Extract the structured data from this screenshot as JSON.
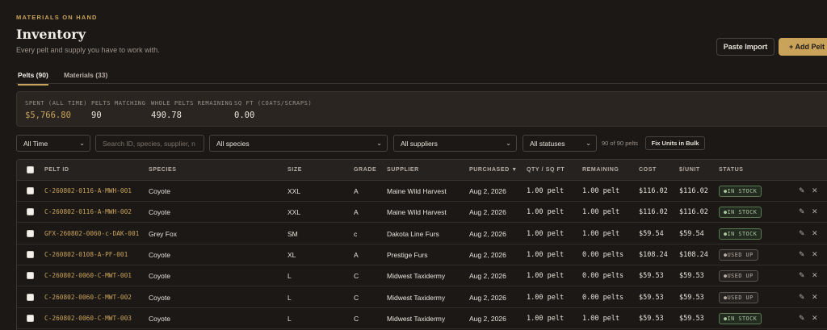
{
  "header": {
    "eyebrow": "MATERIALS ON HAND",
    "title": "Inventory",
    "subtitle": "Every pelt and supply you have to work with.",
    "paste_import_label": "Paste Import",
    "add_pelt_label": "+ Add Pelt"
  },
  "tabs": [
    {
      "label": "Pelts (90)",
      "active": true
    },
    {
      "label": "Materials (33)",
      "active": false
    }
  ],
  "stats": [
    {
      "label": "SPENT (ALL TIME)",
      "value": "$5,766.80"
    },
    {
      "label": "PELTS MATCHING",
      "value": "90"
    },
    {
      "label": "WHOLE PELTS REMAINING",
      "value": "490.78"
    },
    {
      "label": "SQ FT (COATS/SCRAPS)",
      "value": "0.00"
    }
  ],
  "filters": {
    "time": "All Time",
    "search_placeholder": "Search ID, species, supplier, n",
    "species": "All species",
    "suppliers": "All suppliers",
    "statuses": "All statuses",
    "count_text": "90 of 90 pelts",
    "fix_units_label": "Fix Units in Bulk"
  },
  "columns": [
    "PELT ID",
    "SPECIES",
    "SIZE",
    "GRADE",
    "SUPPLIER",
    "PURCHASED ▼",
    "QTY / SQ FT",
    "REMAINING",
    "COST",
    "$/UNIT",
    "STATUS"
  ],
  "rows": [
    {
      "id": "C-260802-0116-A-MWH-001",
      "species": "Coyote",
      "size": "XXL",
      "grade": "A",
      "supplier": "Maine Wild Harvest",
      "purchased": "Aug 2, 2026",
      "qty": "1.00 pelt",
      "remaining": "1.00 pelt",
      "cost": "$116.02",
      "unit": "$116.02",
      "status": "IN STOCK"
    },
    {
      "id": "C-260802-0116-A-MWH-002",
      "species": "Coyote",
      "size": "XXL",
      "grade": "A",
      "supplier": "Maine Wild Harvest",
      "purchased": "Aug 2, 2026",
      "qty": "1.00 pelt",
      "remaining": "1.00 pelt",
      "cost": "$116.02",
      "unit": "$116.02",
      "status": "IN STOCK"
    },
    {
      "id": "GFX-260802-0060-c-DAK-001",
      "species": "Grey Fox",
      "size": "SM",
      "grade": "c",
      "supplier": "Dakota Line Furs",
      "purchased": "Aug 2, 2026",
      "qty": "1.00 pelt",
      "remaining": "1.00 pelt",
      "cost": "$59.54",
      "unit": "$59.54",
      "status": "IN STOCK"
    },
    {
      "id": "C-260802-0108-A-PF-001",
      "species": "Coyote",
      "size": "XL",
      "grade": "A",
      "supplier": "Prestige Furs",
      "purchased": "Aug 2, 2026",
      "qty": "1.00 pelt",
      "remaining": "0.00 pelts",
      "cost": "$108.24",
      "unit": "$108.24",
      "status": "USED UP"
    },
    {
      "id": "C-260802-0060-C-MWT-001",
      "species": "Coyote",
      "size": "L",
      "grade": "C",
      "supplier": "Midwest Taxidermy",
      "purchased": "Aug 2, 2026",
      "qty": "1.00 pelt",
      "remaining": "0.00 pelts",
      "cost": "$59.53",
      "unit": "$59.53",
      "status": "USED UP"
    },
    {
      "id": "C-260802-0060-C-MWT-002",
      "species": "Coyote",
      "size": "L",
      "grade": "C",
      "supplier": "Midwest Taxidermy",
      "purchased": "Aug 2, 2026",
      "qty": "1.00 pelt",
      "remaining": "0.00 pelts",
      "cost": "$59.53",
      "unit": "$59.53",
      "status": "USED UP"
    },
    {
      "id": "C-260802-0060-C-MWT-003",
      "species": "Coyote",
      "size": "L",
      "grade": "C",
      "supplier": "Midwest Taxidermy",
      "purchased": "Aug 2, 2026",
      "qty": "1.00 pelt",
      "remaining": "1.00 pelt",
      "cost": "$59.53",
      "unit": "$59.53",
      "status": "IN STOCK"
    }
  ],
  "icons": {
    "edit": "pencil-icon",
    "delete": "close-icon",
    "dropdown": "chevron-down-icon"
  },
  "colors": {
    "accent": "#c9a35a",
    "background": "#1c1816",
    "in_stock": "#a9c79e",
    "used_up": "#b7aea5"
  }
}
